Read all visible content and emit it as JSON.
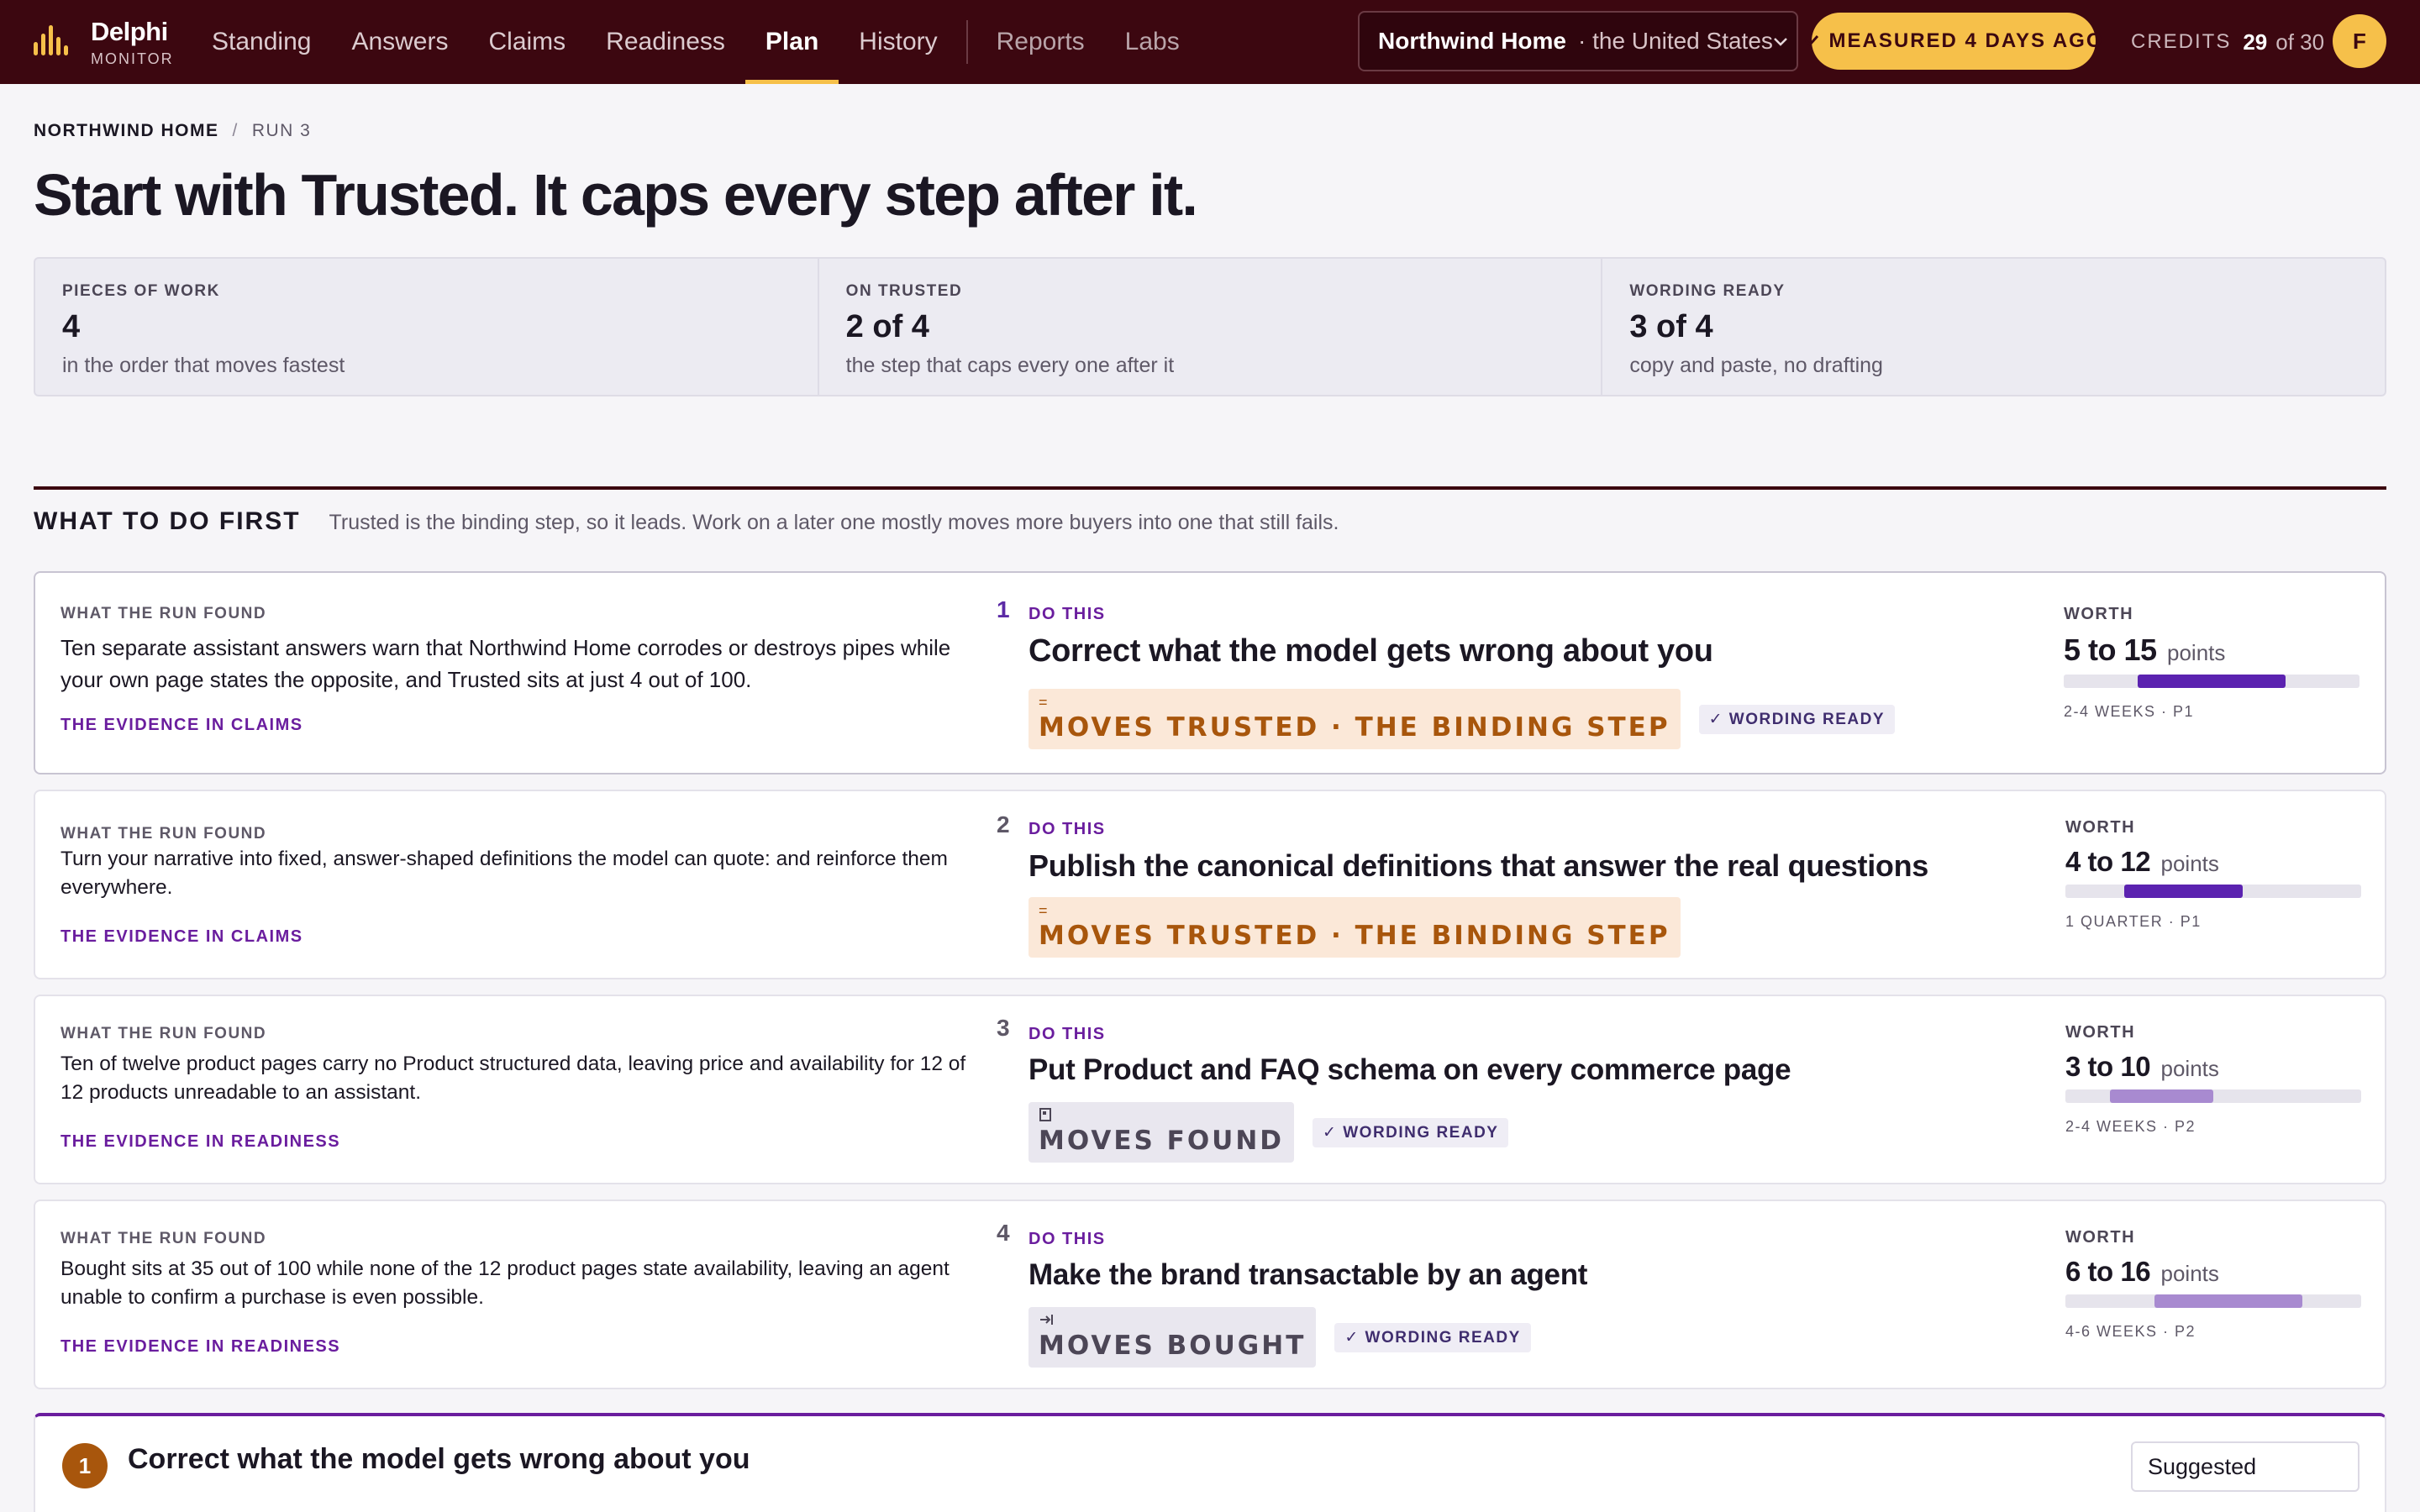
{
  "app": {
    "name": "Delphi",
    "subtitle": "MONITOR"
  },
  "nav": {
    "items": [
      {
        "label": "Standing"
      },
      {
        "label": "Answers"
      },
      {
        "label": "Claims"
      },
      {
        "label": "Readiness"
      },
      {
        "label": "Plan",
        "active": true
      },
      {
        "label": "History"
      }
    ],
    "secondary": [
      {
        "label": "Reports"
      },
      {
        "label": "Labs"
      }
    ]
  },
  "brand_selector": {
    "brand": "Northwind Home",
    "market": "· the United States",
    "icon": "chevron-down-icon"
  },
  "measured_badge": {
    "label": "MEASURED 4 DAYS AGO",
    "icon": "check-icon",
    "color": "#f6c04a"
  },
  "credits": {
    "label": "CREDITS",
    "used": "29",
    "total": "of 30"
  },
  "user": {
    "initial": "F"
  },
  "breadcrumb": {
    "brand": "NORTHWIND HOME",
    "separator": "/",
    "run": "RUN 3"
  },
  "page": {
    "title": "Start with Trusted. It caps every step after it."
  },
  "stats": [
    {
      "label": "PIECES OF WORK",
      "value": "4",
      "sub": "in the order that moves fastest"
    },
    {
      "label": "ON TRUSTED",
      "value": "2 of 4",
      "sub": "the step that caps every one after it"
    },
    {
      "label": "WORDING READY",
      "value": "3 of 4",
      "sub": "copy and paste, no drafting"
    }
  ],
  "section": {
    "title": "WHAT TO DO FIRST",
    "description": "Trusted is the binding step, so it leads. Work on a later one mostly moves more buyers into one that still fails."
  },
  "labels": {
    "found": "WHAT THE RUN FOUND",
    "do": "DO THIS",
    "worth": "WORTH",
    "points": "points"
  },
  "actions": [
    {
      "index": "1",
      "found": "Ten separate assistant answers warn that Northwind Home corrodes or destroys pipes while your own page states the opposite, and Trusted sits at just 4 out of 100.",
      "evidence": "THE EVIDENCE IN CLAIMS",
      "title": "Correct what the model gets wrong about you",
      "move_tag": "MOVES TRUSTED · THE BINDING STEP",
      "move_icon": "equals-icon",
      "wording_ready": "✓ WORDING READY",
      "worth": "5 to 15",
      "worth_range": [
        5,
        15
      ],
      "meta": "2-4 WEEKS · P1"
    },
    {
      "index": "2",
      "found": "Turn your narrative into fixed, answer-shaped definitions the model can quote: and reinforce them everywhere.",
      "evidence": "THE EVIDENCE IN CLAIMS",
      "title": "Publish the canonical definitions that answer the real questions",
      "move_tag": "MOVES TRUSTED · THE BINDING STEP",
      "move_icon": "equals-icon",
      "wording_ready": "",
      "worth": "4 to 12",
      "worth_range": [
        4,
        12
      ],
      "meta": "1 QUARTER · P1"
    },
    {
      "index": "3",
      "found": "Ten of twelve product pages carry no Product structured data, leaving price and availability for 12 of 12 products unreadable to an assistant.",
      "evidence": "THE EVIDENCE IN READINESS",
      "title": "Put Product and FAQ schema on every commerce page",
      "move_tag": "MOVES FOUND",
      "move_icon": "page-icon",
      "wording_ready": "✓ WORDING READY",
      "worth": "3 to 10",
      "worth_range": [
        3,
        10
      ],
      "meta": "2-4 WEEKS · P2"
    },
    {
      "index": "4",
      "found": "Bought sits at 35 out of 100 while none of the 12 product pages state availability, leaving an agent unable to confirm a purchase is even possible.",
      "evidence": "THE EVIDENCE IN READINESS",
      "title": "Make the brand transactable by an agent",
      "move_tag": "MOVES BOUGHT",
      "move_icon": "arrow-to-bar-icon",
      "wording_ready": "✓ WORDING READY",
      "worth": "6 to 16",
      "worth_range": [
        6,
        16
      ],
      "meta": "4-6 WEEKS · P2"
    }
  ],
  "detail": {
    "number": "1",
    "title": "Correct what the model gets wrong about you",
    "status": "Suggested"
  },
  "colors": {
    "topbar": "#3c0710",
    "accent": "#f6c04a",
    "purple": "#6a1d9e",
    "binding": "#a8560c"
  }
}
